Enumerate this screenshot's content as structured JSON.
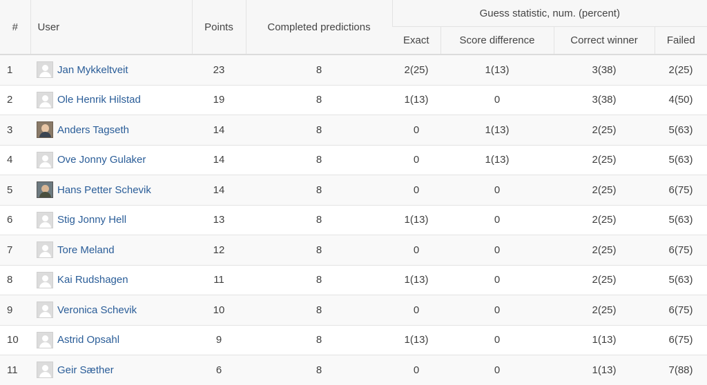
{
  "header": {
    "rank": "#",
    "user": "User",
    "points": "Points",
    "completed": "Completed predictions",
    "guess_group": "Guess statistic, num. (percent)",
    "exact": "Exact",
    "score_diff": "Score difference",
    "correct_winner": "Correct winner",
    "failed": "Failed"
  },
  "rows": [
    {
      "rank": "1",
      "name": "Jan Mykkeltveit",
      "avatar": "default-avatar-icon",
      "points": "23",
      "completed": "8",
      "exact": "2(25)",
      "score_diff": "1(13)",
      "winner": "3(38)",
      "failed": "2(25)"
    },
    {
      "rank": "2",
      "name": "Ole Henrik Hilstad",
      "avatar": "default-avatar-icon",
      "points": "19",
      "completed": "8",
      "exact": "1(13)",
      "score_diff": "0",
      "winner": "3(38)",
      "failed": "4(50)"
    },
    {
      "rank": "3",
      "name": "Anders Tagseth",
      "avatar": "photo-avatar",
      "points": "14",
      "completed": "8",
      "exact": "0",
      "score_diff": "1(13)",
      "winner": "2(25)",
      "failed": "5(63)"
    },
    {
      "rank": "4",
      "name": "Ove Jonny Gulaker",
      "avatar": "default-avatar-icon",
      "points": "14",
      "completed": "8",
      "exact": "0",
      "score_diff": "1(13)",
      "winner": "2(25)",
      "failed": "5(63)"
    },
    {
      "rank": "5",
      "name": "Hans Petter Schevik",
      "avatar": "photo-avatar",
      "points": "14",
      "completed": "8",
      "exact": "0",
      "score_diff": "0",
      "winner": "2(25)",
      "failed": "6(75)"
    },
    {
      "rank": "6",
      "name": "Stig Jonny Hell",
      "avatar": "default-avatar-icon",
      "points": "13",
      "completed": "8",
      "exact": "1(13)",
      "score_diff": "0",
      "winner": "2(25)",
      "failed": "5(63)"
    },
    {
      "rank": "7",
      "name": "Tore Meland",
      "avatar": "default-avatar-icon",
      "points": "12",
      "completed": "8",
      "exact": "0",
      "score_diff": "0",
      "winner": "2(25)",
      "failed": "6(75)"
    },
    {
      "rank": "8",
      "name": "Kai Rudshagen",
      "avatar": "default-avatar-icon",
      "points": "11",
      "completed": "8",
      "exact": "1(13)",
      "score_diff": "0",
      "winner": "2(25)",
      "failed": "5(63)"
    },
    {
      "rank": "9",
      "name": "Veronica Schevik",
      "avatar": "default-avatar-icon",
      "points": "10",
      "completed": "8",
      "exact": "0",
      "score_diff": "0",
      "winner": "2(25)",
      "failed": "6(75)"
    },
    {
      "rank": "10",
      "name": "Astrid Opsahl",
      "avatar": "default-avatar-icon",
      "points": "9",
      "completed": "8",
      "exact": "1(13)",
      "score_diff": "0",
      "winner": "1(13)",
      "failed": "6(75)"
    },
    {
      "rank": "11",
      "name": "Geir Sæther",
      "avatar": "default-avatar-icon",
      "points": "6",
      "completed": "8",
      "exact": "0",
      "score_diff": "0",
      "winner": "1(13)",
      "failed": "7(88)"
    }
  ],
  "colors": {
    "link": "#2a5d98",
    "header_bg": "#f7f7f7",
    "stripe": "#f9f9f9",
    "border": "#e3e3e3"
  }
}
